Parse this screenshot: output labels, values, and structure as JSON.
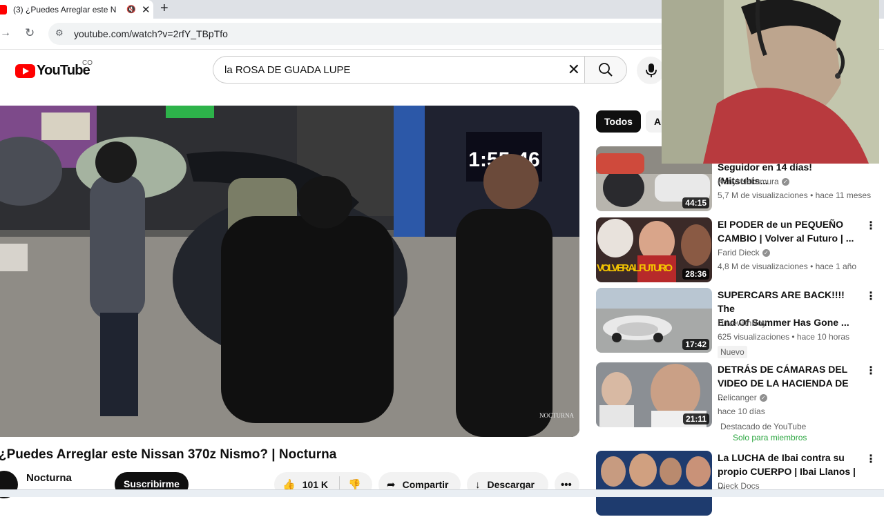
{
  "browser": {
    "tab_title": "(3) ¿Puedes Arreglar este N",
    "new_tab": "+",
    "tab_close": "✕",
    "url": "youtube.com/watch?v=2rfY_TBpTfo"
  },
  "masthead": {
    "logo_text": "YouTube",
    "country_code": "CO",
    "search_query": "la ROSA DE GUADA LUPE"
  },
  "player": {
    "timer_overlay": "1:55:46",
    "watermark": "NOCTURNA"
  },
  "video": {
    "title": "¿Puedes Arreglar este Nissan 370z Nismo? | Nocturna",
    "channel": "Nocturna",
    "subscribe_label": "Suscribirme",
    "likes": "101 K",
    "share_label": "Compartir",
    "download_label": "Descargar"
  },
  "chips": [
    "Todos",
    "Au"
  ],
  "recommendations": [
    {
      "title_line1": "Seguidor en 14 días! (Mitsubis...",
      "title_line2": "",
      "channel": "Kenyi Nakamura",
      "verified": true,
      "meta": "5,7 M de visualizaciones • hace 11 meses",
      "duration": "44:15"
    },
    {
      "title_line1": "El PODER de un PEQUEÑO",
      "title_line2": "CAMBIO | Volver al Futuro | ...",
      "channel": "Farid Dieck",
      "verified": true,
      "meta": "4,8 M de visualizaciones • hace 1 año",
      "duration": "28:36",
      "thumb_text": "VOLVER AL FUTURO"
    },
    {
      "title_line1": "SUPERCARS ARE BACK!!!! The",
      "title_line2": "End Of Summer Has Gone ...",
      "channel": "DrivewithRoy",
      "verified": false,
      "meta": "625 visualizaciones • hace 10 horas",
      "duration": "17:42",
      "badge": "Nuevo"
    },
    {
      "title_line1": "DETRÁS DE CÁMARAS DEL",
      "title_line2": "VIDEO DE LA HACIENDA DE ...",
      "channel": "Pelicanger",
      "verified": true,
      "meta": "hace 10 días",
      "duration": "21:11",
      "badge": "Destacado de YouTube",
      "members": "Solo para miembros"
    },
    {
      "title_line1": "La LUCHA de Ibai contra su",
      "title_line2": "propio CUERPO | Ibai Llanos | ...",
      "channel": "Dieck Docs",
      "verified": false,
      "meta": "",
      "duration": ""
    }
  ]
}
